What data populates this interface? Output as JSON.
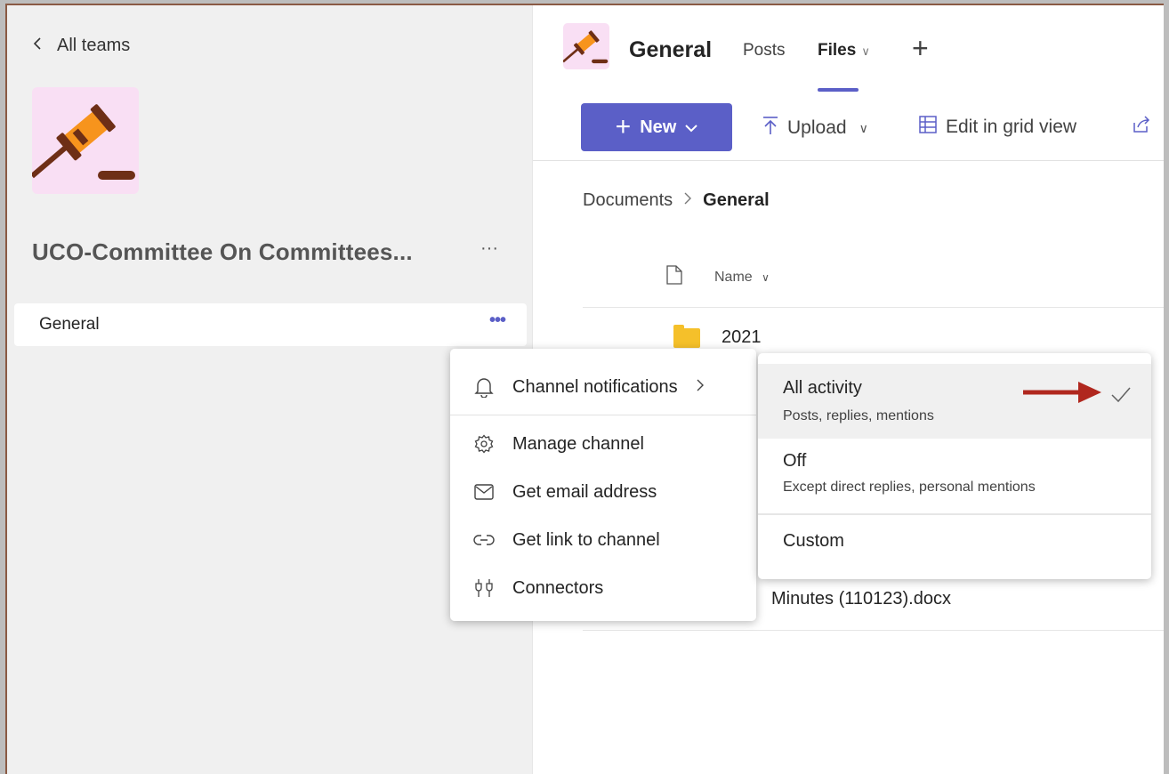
{
  "nav": {
    "back_label": "All teams"
  },
  "team": {
    "name": "UCO-Committee On Committees...",
    "more": "···"
  },
  "channels": [
    {
      "label": "General",
      "more": "•••"
    }
  ],
  "header": {
    "channel_title": "General",
    "tabs": [
      {
        "label": "Posts",
        "active": false
      },
      {
        "label": "Files",
        "active": true
      }
    ],
    "add_tab": "+"
  },
  "toolbar": {
    "new_label": "New",
    "upload_label": "Upload",
    "grid_label": "Edit in grid view"
  },
  "breadcrumb": {
    "root": "Documents",
    "current": "General"
  },
  "files": {
    "column_name": "Name",
    "rows": [
      {
        "name": "2021",
        "type": "folder"
      },
      {
        "name": "Minutes (110123).docx",
        "type": "docx"
      }
    ]
  },
  "context_menu": {
    "items": [
      {
        "label": "Channel notifications",
        "icon": "bell-icon",
        "has_submenu": true
      },
      {
        "label": "Manage channel",
        "icon": "gear-icon"
      },
      {
        "label": "Get email address",
        "icon": "mail-icon"
      },
      {
        "label": "Get link to channel",
        "icon": "link-icon"
      },
      {
        "label": "Connectors",
        "icon": "connector-icon"
      }
    ]
  },
  "notifications_submenu": {
    "items": [
      {
        "title": "All activity",
        "subtitle": "Posts, replies, mentions",
        "selected": true
      },
      {
        "title": "Off",
        "subtitle": "Except direct replies, personal mentions",
        "selected": false
      },
      {
        "title": "Custom",
        "subtitle": "",
        "selected": false
      }
    ]
  },
  "colors": {
    "accent": "#5b5fc7",
    "annotation_arrow": "#b0271e",
    "avatar_bg": "#f9dff4"
  }
}
